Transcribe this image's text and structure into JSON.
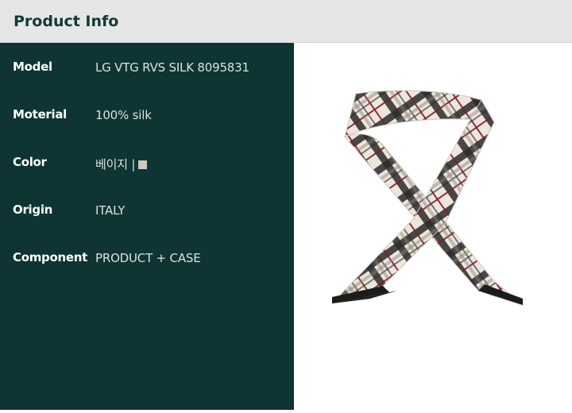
{
  "header": {
    "title": "Product Info"
  },
  "specs": [
    {
      "label": "Model",
      "value": "LG VTG RVS SILK 8095831"
    },
    {
      "label": "Moterial",
      "value": "100% silk"
    },
    {
      "label": "Color",
      "value": "베이지 |",
      "swatch_color": "#d2c8ba"
    },
    {
      "label": "Origin",
      "value": "ITALY"
    },
    {
      "label": "Component",
      "value": "PRODUCT + CASE"
    }
  ],
  "colors": {
    "panel": "#0e3433",
    "header_bg": "#e6e6e6",
    "scarf_base": "#ece6dc",
    "check_dark": "#2b2b2b",
    "check_red": "#7a1f2a"
  }
}
